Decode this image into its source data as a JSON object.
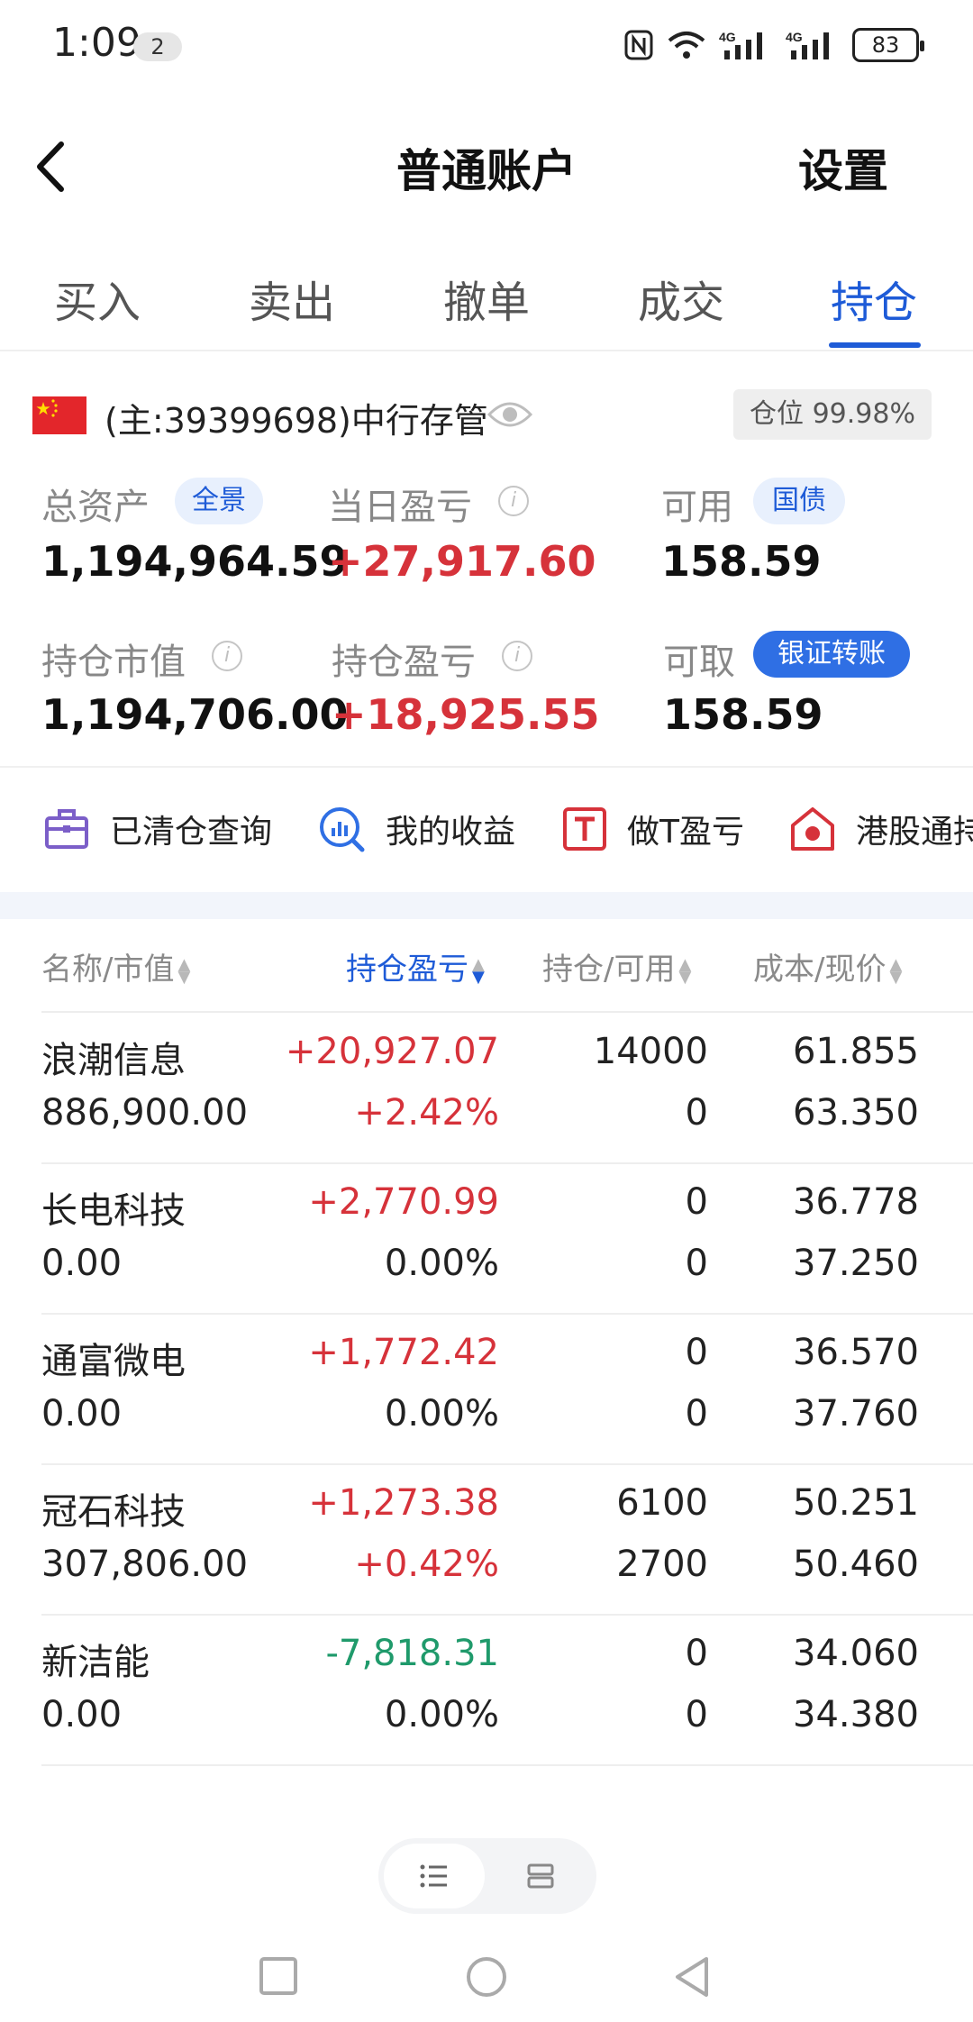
{
  "status_bar": {
    "time": "1:09",
    "notification_count": "2",
    "network_1": "4G",
    "network_2": "4G",
    "battery": "83"
  },
  "nav": {
    "title": "普通账户",
    "settings": "设置"
  },
  "tabs": [
    {
      "label": "买入",
      "active": false
    },
    {
      "label": "卖出",
      "active": false
    },
    {
      "label": "撤单",
      "active": false
    },
    {
      "label": "成交",
      "active": false
    },
    {
      "label": "持仓",
      "active": true
    }
  ],
  "account": {
    "label": "(主:39399698)中行存管",
    "position_ratio": "仓位 99.98%"
  },
  "summary": {
    "total_assets": {
      "label": "总资产",
      "value": "1,194,964.59",
      "pill": "全景"
    },
    "daily_pnl": {
      "label": "当日盈亏",
      "value": "+27,917.60"
    },
    "available": {
      "label": "可用",
      "value": "158.59",
      "pill": "国债"
    },
    "market_value": {
      "label": "持仓市值",
      "value": "1,194,706.00"
    },
    "position_pnl": {
      "label": "持仓盈亏",
      "value": "+18,925.55"
    },
    "withdrawable": {
      "label": "可取",
      "value": "158.59",
      "pill": "银证转账"
    }
  },
  "shortcuts": [
    {
      "label": "已清仓查询",
      "icon": "briefcase-icon"
    },
    {
      "label": "我的收益",
      "icon": "chart-search-icon"
    },
    {
      "label": "做T盈亏",
      "icon": "t-box-icon"
    },
    {
      "label": "港股通持",
      "icon": "hk-house-icon"
    }
  ],
  "table": {
    "headers": [
      "名称/市值",
      "持仓盈亏",
      "持仓/可用",
      "成本/现价"
    ],
    "rows": [
      {
        "name": "浪潮信息",
        "market_value": "886,900.00",
        "pnl": "+20,927.07",
        "pnl_pct": "+2.42%",
        "holding": "14000",
        "available": "0",
        "cost": "61.855",
        "price": "63.350",
        "pnl_color": "red",
        "pct_color": "red"
      },
      {
        "name": "长电科技",
        "market_value": "0.00",
        "pnl": "+2,770.99",
        "pnl_pct": "0.00%",
        "holding": "0",
        "available": "0",
        "cost": "36.778",
        "price": "37.250",
        "pnl_color": "red",
        "pct_color": "plain"
      },
      {
        "name": "通富微电",
        "market_value": "0.00",
        "pnl": "+1,772.42",
        "pnl_pct": "0.00%",
        "holding": "0",
        "available": "0",
        "cost": "36.570",
        "price": "37.760",
        "pnl_color": "red",
        "pct_color": "plain"
      },
      {
        "name": "冠石科技",
        "market_value": "307,806.00",
        "pnl": "+1,273.38",
        "pnl_pct": "+0.42%",
        "holding": "6100",
        "available": "2700",
        "cost": "50.251",
        "price": "50.460",
        "pnl_color": "red",
        "pct_color": "red"
      },
      {
        "name": "新洁能",
        "market_value": "0.00",
        "pnl": "-7,818.31",
        "pnl_pct": "0.00%",
        "holding": "0",
        "available": "0",
        "cost": "34.060",
        "price": "34.380",
        "pnl_color": "green",
        "pct_color": "plain"
      }
    ]
  },
  "colors": {
    "accent": "#1e5bd7",
    "gain": "#d6323a",
    "loss": "#1f9a6b"
  }
}
